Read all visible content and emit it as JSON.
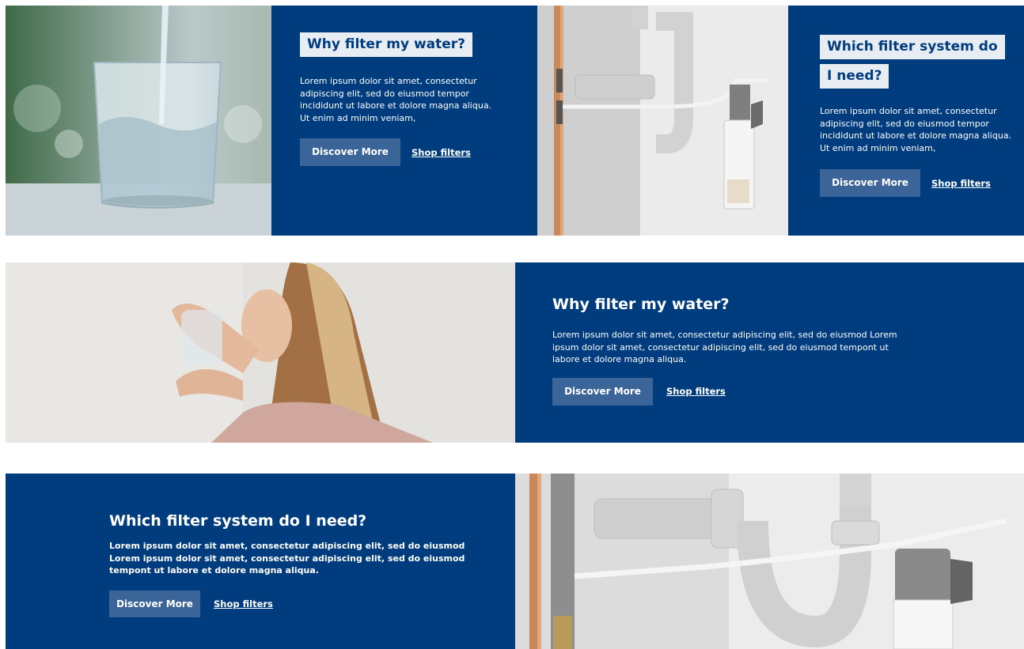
{
  "banner1": {
    "title": "Why filter my water?",
    "body": "Lorem ipsum dolor sit amet, consectetur adipiscing elit, sed do eiusmod tempor incididunt ut labore et dolore magna aliqua. Ut enim ad minim veniam,",
    "button_label": "Discover More",
    "link_label": "Shop filters"
  },
  "banner2": {
    "title_line1": "Which filter system do",
    "title_line2": "I need?",
    "body": "Lorem ipsum dolor sit amet, consectetur adipiscing elit, sed do eiusmod tempor incididunt ut labore et dolore magna aliqua. Ut enim ad minim veniam,",
    "button_label": "Discover More",
    "link_label": "Shop filters"
  },
  "banner3": {
    "title": "Why filter my water?",
    "body": "Lorem ipsum dolor sit amet, consectetur adipiscing elit, sed do eiusmod Lorem ipsum dolor sit amet, consectetur adipiscing elit, sed do eiusmod tempont ut labore et dolore magna aliqua.",
    "button_label": "Discover More",
    "link_label": "Shop filters"
  },
  "banner4": {
    "title": "Which filter system do I need?",
    "body": "Lorem ipsum dolor sit amet, consectetur adipiscing elit, sed do eiusmod Lorem ipsum dolor sit amet, consectetur adipiscing elit, sed do eiusmod tempont ut labore et dolore magna aliqua.",
    "button_label": "Discover More",
    "link_label": "Shop filters"
  },
  "colors": {
    "panel_blue": "#003c7e",
    "button_blue": "#3b6598",
    "title_highlight": "#e8edf4"
  }
}
